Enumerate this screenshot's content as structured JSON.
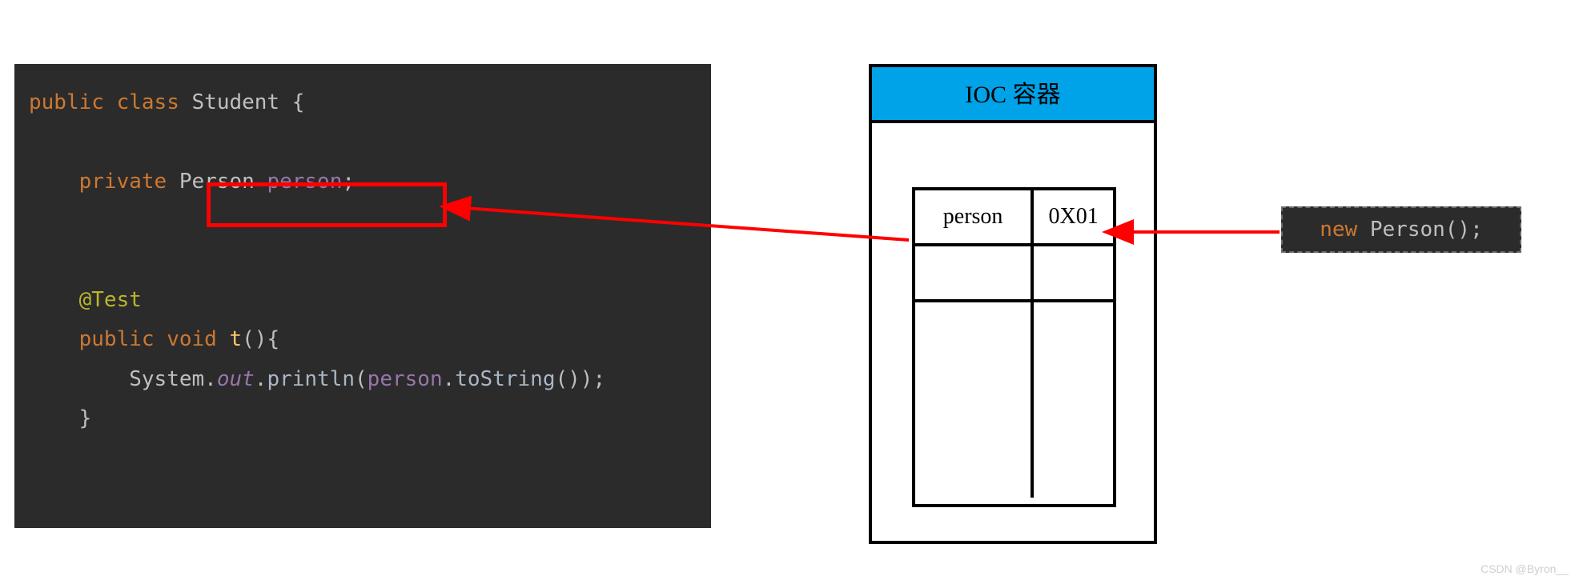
{
  "code": {
    "kw_public": "public",
    "kw_class": "class",
    "cls_name": "Student",
    "brace_open": "{",
    "kw_private": "private",
    "field_type": "Person",
    "field_name": "person",
    "semi": ";",
    "ann_test": "@Test",
    "kw_public2": "public",
    "kw_void": "void",
    "fn_name": "t",
    "paren_empty": "()",
    "brace_open2": "{",
    "sys": "System",
    "dot": ".",
    "out": "out",
    "println": "println",
    "arg_open": "(",
    "arg_person": "person",
    "arg_tostr": "toString",
    "arg_close": "());",
    "brace_close2": "}"
  },
  "ioc": {
    "title": "IOC 容器",
    "rows": [
      {
        "key": "person",
        "val": "0X01"
      }
    ]
  },
  "snippet": {
    "kw_new": "new",
    "typ": "Person",
    "tail": "();"
  },
  "watermark": "CSDN @Byron__"
}
